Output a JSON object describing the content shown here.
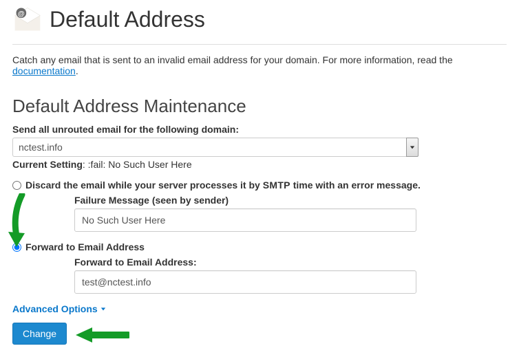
{
  "header": {
    "title": "Default Address"
  },
  "intro": {
    "text_before": "Catch any email that is sent to an invalid email address for your domain. For more information, read the ",
    "link_text": "documentation",
    "text_after": "."
  },
  "section": {
    "title": "Default Address Maintenance",
    "domain_label": "Send all unrouted email for the following domain:",
    "domain_value": "nctest.info",
    "current_setting_label": "Current Setting",
    "current_setting_value": ": :fail: No Such User Here"
  },
  "options": {
    "discard": {
      "label_before": "Discard the email while your server processes it by ",
      "smtp": "SMTP",
      "label_after": " time with an error message.",
      "failure_label": "Failure Message (seen by sender)",
      "failure_value": "No Such User Here"
    },
    "forward": {
      "label": "Forward to Email Address",
      "field_label": "Forward to Email Address:",
      "field_value": "test@nctest.info"
    }
  },
  "advanced_label": "Advanced Options",
  "change_button": "Change"
}
